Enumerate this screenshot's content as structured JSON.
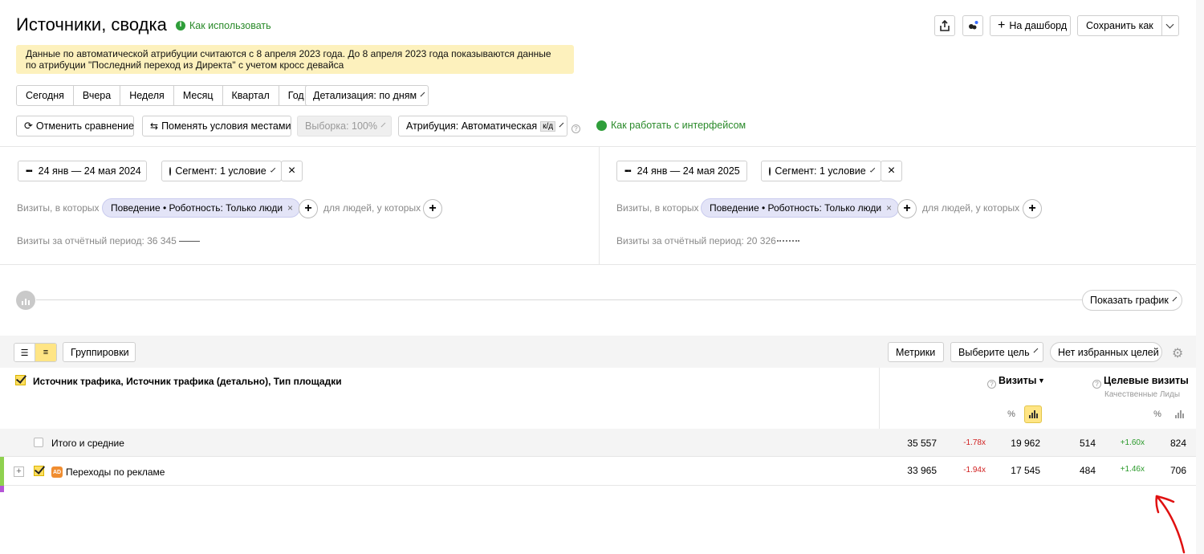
{
  "header": {
    "title": "Источники, сводка",
    "how_to_use": "Как использовать",
    "to_dashboard": "На дашборд",
    "save_as": "Сохранить как"
  },
  "notice": "Данные по автоматической атрибуции считаются с 8 апреля 2023 года. До 8 апреля 2023 года показываются данные по атрибуции \"Последний переход из Директа\" с учетом кросс девайса",
  "periods": [
    "Сегодня",
    "Вчера",
    "Неделя",
    "Месяц",
    "Квартал",
    "Год"
  ],
  "detail": "Детализация: по дням",
  "toolbar2": {
    "cancel_compare": "Отменить сравнение",
    "swap": "Поменять условия местами",
    "sample": "Выборка: 100%",
    "attribution": "Атрибуция: Автоматическая",
    "attribution_badge": "к/д",
    "interface_help": "Как работать с интерфейсом"
  },
  "left_panel": {
    "date_range": "24 янв — 24 мая 2024",
    "segment": "Сегмент: 1 условие",
    "visits_where": "Визиты, в которых",
    "chip": "Поведение • Роботность: Только люди",
    "people_where": "для людей, у которых",
    "visits_period": "Визиты за отчётный период: 36 345"
  },
  "right_panel": {
    "date_range": "24 янв — 24 мая 2025",
    "segment": "Сегмент: 1 условие",
    "visits_where": "Визиты, в которых",
    "chip": "Поведение • Роботность: Только люди",
    "people_where": "для людей, у которых",
    "visits_period": "Визиты за отчётный период: 20 326"
  },
  "show_chart": "Показать график",
  "table_toolbar": {
    "groupings": "Группировки",
    "metrics": "Метрики",
    "choose_goal": "Выберите цель",
    "no_fav_goals": "Нет избранных целей"
  },
  "table": {
    "dimension_header": "Источник трафика, Источник трафика (детально), Тип площадки",
    "col_visits": "Визиты",
    "col_visits_sort": "▼",
    "col_goal_visits": "Целевые визиты",
    "col_goal_sub": "Качественные Лиды",
    "percent_symbol": "%",
    "rows": [
      {
        "label": "Итого и средние",
        "v1": "35 557",
        "d1": "-1.78x",
        "v2": "19 962",
        "g1": "514",
        "d2": "+1.60x",
        "g2": "824"
      },
      {
        "label": "Переходы по рекламе",
        "badge": "AD",
        "v1": "33 965",
        "d1": "-1.94x",
        "v2": "17 545",
        "g1": "484",
        "d2": "+1.46x",
        "g2": "706"
      }
    ]
  },
  "colors": {
    "notice_bg": "#fdf1bd",
    "chip_bg": "#e3e4f7",
    "accent_yellow": "#ffdf60",
    "negative": "#d02020",
    "positive": "#2a9a2a",
    "arrow_red": "#e01010"
  }
}
